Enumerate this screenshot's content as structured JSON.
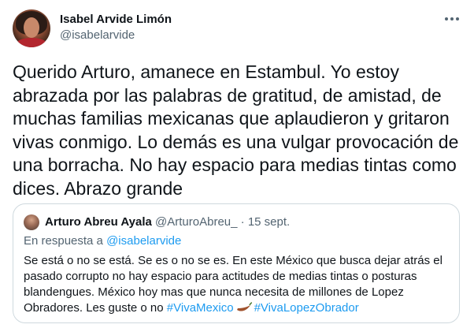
{
  "tweet": {
    "author_name": "Isabel Arvide Limón",
    "author_handle": "@isabelarvide",
    "text": "Querido Arturo, amanece en Estambul. Yo estoy\nabrazada por las palabras de gratitud, de amistad, de\nmuchas familias mexicanas que aplaudieron y gritaron\nvivas conmigo. Lo demás es una vulgar provocación de\nuna borracha. No hay espacio para medias tintas como\ndices. Abrazo grande",
    "more_icon": "more-dots-icon"
  },
  "quoted": {
    "author_name": "Arturo Abreu Ayala",
    "author_handle": "@ArturoAbreu_",
    "separator": "·",
    "date": "15 sept.",
    "reply_prefix": "En respuesta a",
    "reply_mention": "@isabelarvide",
    "text": "Se está o no se está. Se es o no se es. En este México que busca dejar atrás el\npasado corrupto no hay espacio para actitudes de medias tintas o posturas\nblandengues. México hoy mas que nunca necesita de millones de Lopez\nObradores. Les guste o no",
    "hashtag_1": "#VivaMexico",
    "emoji_icon": "pepper-icon",
    "hashtag_2": "#VivaLopezObrador"
  },
  "colors": {
    "text": "#0f1419",
    "secondary": "#536471",
    "link": "#1d9bf0",
    "border": "#cfd9de"
  }
}
